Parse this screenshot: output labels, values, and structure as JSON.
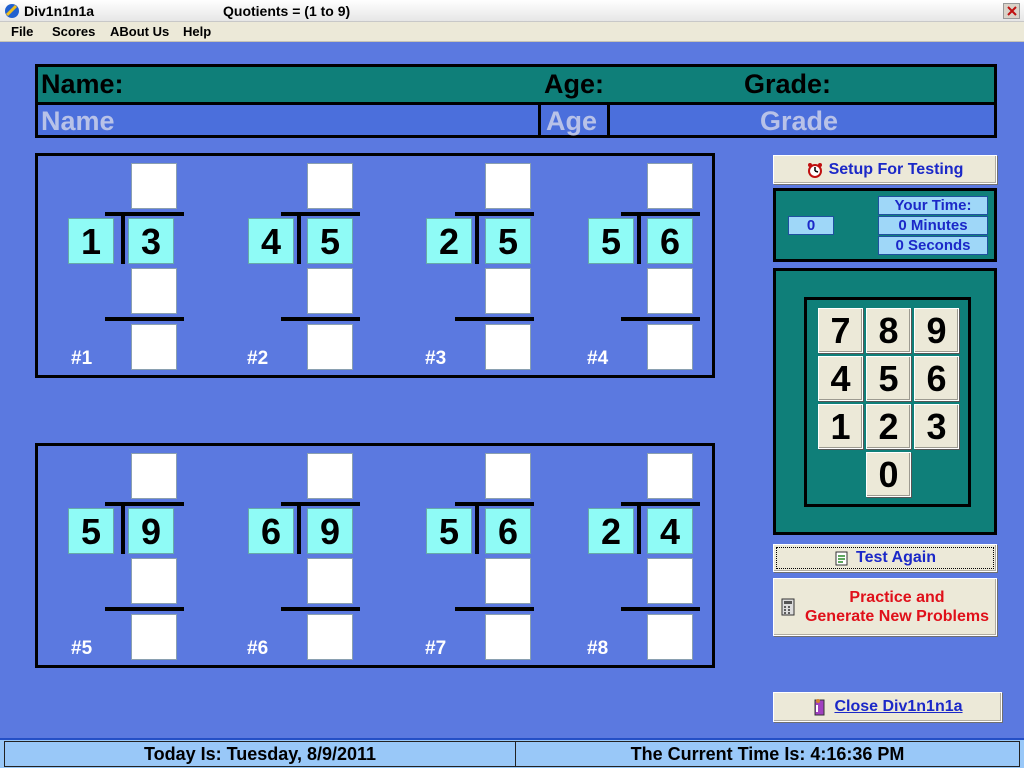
{
  "window": {
    "app_title": "Div1n1n1a",
    "subtitle": "Quotients = (1 to 9)"
  },
  "menu": [
    "File",
    "Scores",
    "ABout Us",
    "Help"
  ],
  "header": {
    "name_label": "Name:",
    "age_label": "Age:",
    "grade_label": "Grade:",
    "name_value": "Name",
    "age_value": "Age",
    "grade_value": "Grade"
  },
  "problems": [
    {
      "num": "#1",
      "divisor": "1",
      "dividend": "3"
    },
    {
      "num": "#2",
      "divisor": "4",
      "dividend": "5"
    },
    {
      "num": "#3",
      "divisor": "2",
      "dividend": "5"
    },
    {
      "num": "#4",
      "divisor": "5",
      "dividend": "6"
    },
    {
      "num": "#5",
      "divisor": "5",
      "dividend": "9"
    },
    {
      "num": "#6",
      "divisor": "6",
      "dividend": "9"
    },
    {
      "num": "#7",
      "divisor": "5",
      "dividend": "6"
    },
    {
      "num": "#8",
      "divisor": "2",
      "dividend": "4"
    }
  ],
  "buttons": {
    "setup": "Setup  For Testing",
    "test_again": "Test Again",
    "practice_line1": "Practice and",
    "practice_line2": "Generate New Problems",
    "close": "Close Div1n1n1a"
  },
  "timer": {
    "counter": "0",
    "label": "Your Time:",
    "minutes": "0 Minutes",
    "seconds": "0 Seconds"
  },
  "keypad": [
    "7",
    "8",
    "9",
    "4",
    "5",
    "6",
    "1",
    "2",
    "3",
    "0"
  ],
  "status": {
    "date": "Today Is:  Tuesday, 8/9/2011",
    "time": "The Current Time Is:    4:16:36 PM"
  },
  "colors": {
    "background": "#5b79e0",
    "teal": "#0f7f79",
    "digit_bg": "#8ffbf6",
    "practice_text": "#e0101a",
    "blue_text": "#1b28c8"
  }
}
